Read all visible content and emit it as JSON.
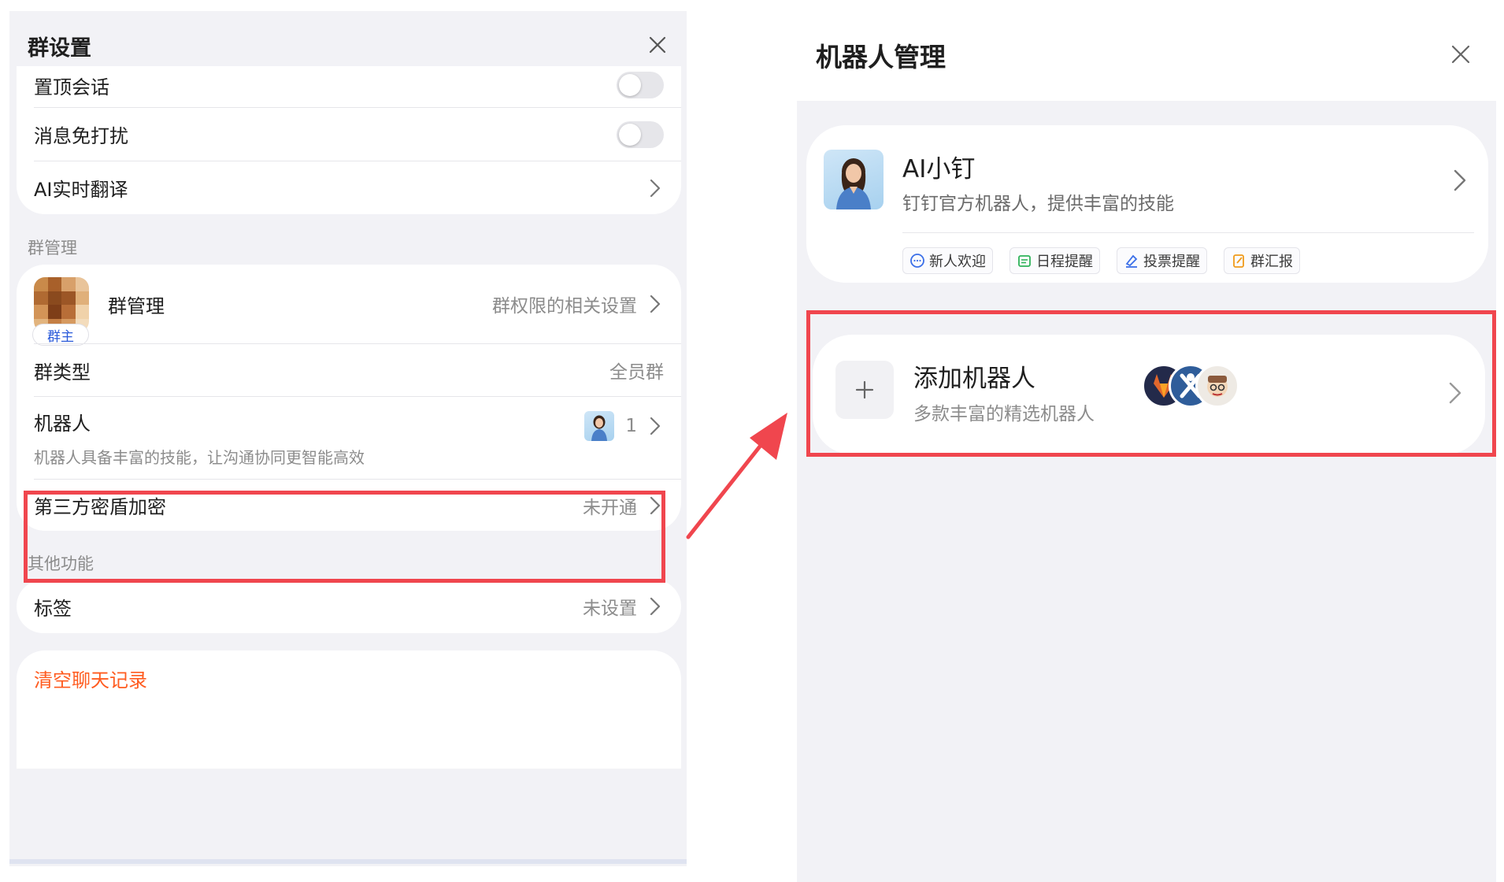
{
  "left": {
    "title": "群设置",
    "rows_top": [
      {
        "label": "置顶会话",
        "type": "toggle",
        "on": false
      },
      {
        "label": "消息免打扰",
        "type": "toggle",
        "on": false
      },
      {
        "label": "AI实时翻译",
        "type": "link"
      }
    ],
    "group_mgmt_section": "群管理",
    "group_mgmt": {
      "badge": "群主",
      "label": "群管理",
      "value": "群权限的相关设置"
    },
    "group_type": {
      "label": "群类型",
      "value": "全员群"
    },
    "robot": {
      "label": "机器人",
      "sub": "机器人具备丰富的技能，让沟通协同更智能高效",
      "count": "1"
    },
    "encryption": {
      "label": "第三方密盾加密",
      "value": "未开通"
    },
    "other_section": "其他功能",
    "tags": {
      "label": "标签",
      "value": "未设置"
    },
    "clear_history": {
      "label": "清空聊天记录",
      "color": "#ff5b1f"
    }
  },
  "right": {
    "title": "机器人管理",
    "bot": {
      "name": "AI小钉",
      "desc": "钉钉官方机器人，提供丰富的技能",
      "skills": [
        {
          "label": "新人欢迎",
          "icon": "chat-bubble-icon",
          "color": "#3b6fe8"
        },
        {
          "label": "日程提醒",
          "icon": "calendar-icon",
          "color": "#2fb35a"
        },
        {
          "label": "投票提醒",
          "icon": "vote-icon",
          "color": "#3b6fe8"
        },
        {
          "label": "群汇报",
          "icon": "report-icon",
          "color": "#f09a1a"
        }
      ]
    },
    "add_robot": {
      "title": "添加机器人",
      "sub": "多款丰富的精选机器人"
    }
  },
  "colors": {
    "highlight": "#f0464e",
    "arrow": "#f0464e",
    "link_blue": "#2a5ada"
  }
}
